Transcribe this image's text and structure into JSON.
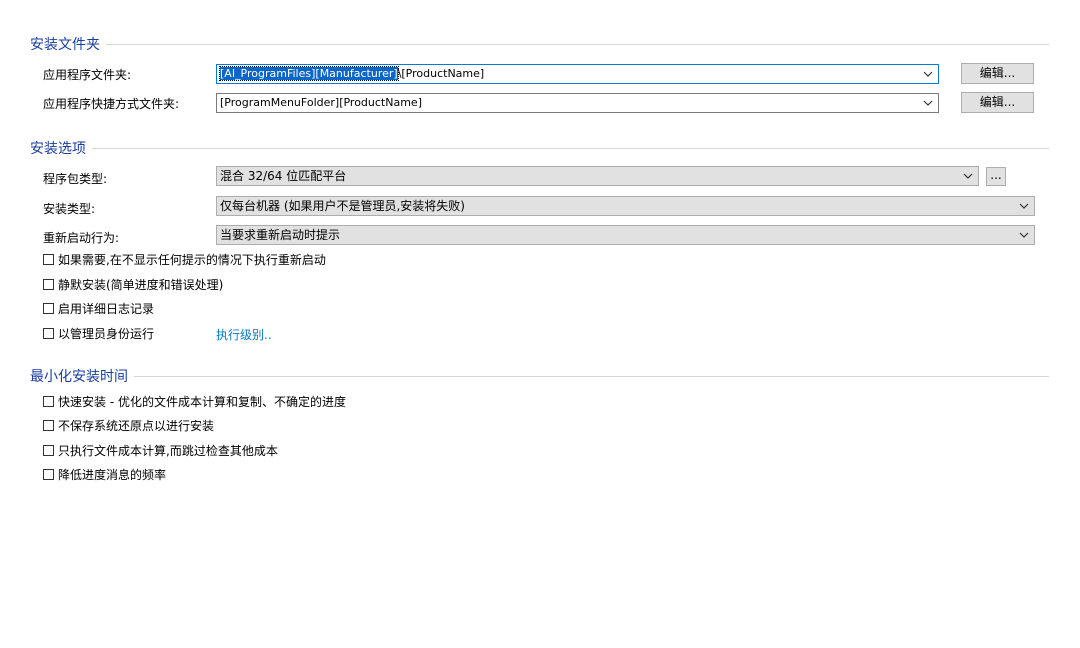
{
  "install_folders": {
    "section_title": "安装文件夹",
    "app_folder_label": "应用程序文件夹:",
    "app_folder_selected": "[AI_ProgramFiles][Manufacturer]",
    "app_folder_rest": "\\[ProductName]",
    "shortcut_folder_label": "应用程序快捷方式文件夹:",
    "shortcut_folder_value": "[ProgramMenuFolder][ProductName]",
    "edit_label": "编辑..."
  },
  "install_options": {
    "section_title": "安装选项",
    "package_type_label": "程序包类型:",
    "package_type_value": "混合 32/64 位匹配平台",
    "more_button_label": "...",
    "install_type_label": "安装类型:",
    "install_type_value": "仅每台机器 (如果用户不是管理员,安装将失败)",
    "reboot_label": "重新启动行为:",
    "reboot_value": "当要求重新启动时提示",
    "checkboxes": [
      "如果需要,在不显示任何提示的情况下执行重新启动",
      "静默安装(简单进度和错误处理)",
      "启用详细日志记录",
      "以管理员身份运行"
    ],
    "exec_level_link": "执行级别.."
  },
  "minimize_time": {
    "section_title": "最小化安装时间",
    "checkboxes": [
      "快速安装 - 优化的文件成本计算和复制、不确定的进度",
      "不保存系统还原点以进行安装",
      "只执行文件成本计算,而跳过检查其他成本",
      "降低进度消息的频率"
    ]
  }
}
